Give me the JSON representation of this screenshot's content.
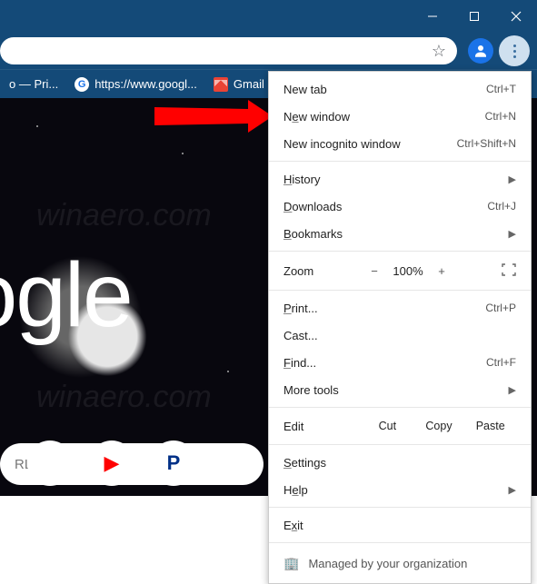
{
  "bookmarks": {
    "item0": "o — Pri...",
    "item1": "https://www.googl...",
    "item2": "Gmail"
  },
  "page": {
    "logo_fragment": "oogle",
    "search_placeholder": "RL",
    "watermark": "winaero.com"
  },
  "menu": {
    "new_tab": "New tab",
    "new_tab_sc": "Ctrl+T",
    "new_window_pre": "N",
    "new_window_u": "e",
    "new_window_post": "w window",
    "new_window_sc": "Ctrl+N",
    "incognito": "New incognito window",
    "incognito_sc": "Ctrl+Shift+N",
    "history_u": "H",
    "history_post": "istory",
    "downloads_u": "D",
    "downloads_post": "ownloads",
    "downloads_sc": "Ctrl+J",
    "bookmarks_u": "B",
    "bookmarks_post": "ookmarks",
    "zoom": "Zoom",
    "zoom_minus": "−",
    "zoom_val": "100%",
    "zoom_plus": "+",
    "print_u": "P",
    "print_post": "rint...",
    "print_sc": "Ctrl+P",
    "cast": "Cast...",
    "find_u": "F",
    "find_post": "ind...",
    "find_sc": "Ctrl+F",
    "more_tools": "More tools",
    "edit": "Edit",
    "cut": "Cut",
    "copy": "Copy",
    "paste": "Paste",
    "settings_u": "S",
    "settings_post": "ettings",
    "help_pre": "H",
    "help_u": "e",
    "help_post": "lp",
    "exit_pre": "E",
    "exit_u": "x",
    "exit_post": "it",
    "managed": "Managed by your organization"
  }
}
